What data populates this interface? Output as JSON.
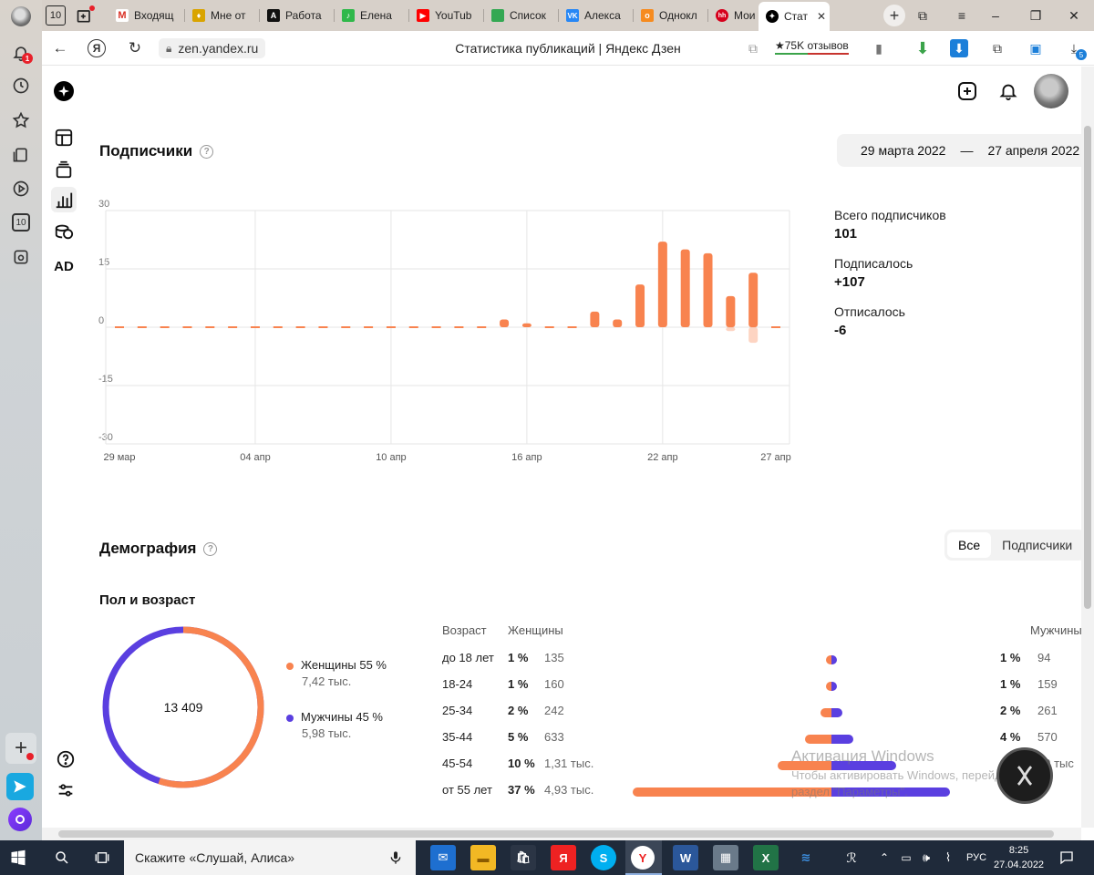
{
  "colors": {
    "orange": "#f8834f",
    "purple": "#5a3fe0"
  },
  "browser": {
    "tabs": [
      {
        "label": "Входящ",
        "icon": "gmail-icon",
        "color": "#d93025"
      },
      {
        "label": "Мне от",
        "icon": "shield-icon",
        "color": "#d9a400"
      },
      {
        "label": "Работа",
        "icon": "a-icon",
        "color": "#111111"
      },
      {
        "label": "Елена ",
        "icon": "music-icon",
        "color": "#2fb84a"
      },
      {
        "label": "YouTub",
        "icon": "youtube-icon",
        "color": "#ff0000"
      },
      {
        "label": "Список",
        "icon": "sheet-icon",
        "color": "#34a853"
      },
      {
        "label": "Алекса",
        "icon": "vk-icon",
        "color": "#2787f5"
      },
      {
        "label": "Однокл",
        "icon": "ok-icon",
        "color": "#f68b1f"
      },
      {
        "label": "Мои ре",
        "icon": "hh-icon",
        "color": "#d6001c"
      }
    ],
    "active_tab": {
      "label": "Стат",
      "icon": "zen-icon"
    },
    "tab_count": "10",
    "sidebar_badge": "1",
    "sidebar_counter": "10",
    "url": "zen.yandex.ru",
    "page_title": "Статистика публикаций | Яндекс Дзен",
    "reviews": "★75K отзывов",
    "downloads_badge": "5",
    "ya_letter": "Я"
  },
  "nav": {
    "ad_label": "AD"
  },
  "subscribers": {
    "title": "Подписчики",
    "date_from": "29 марта 2022",
    "date_sep": "—",
    "date_to": "27 апреля 2022",
    "stats": [
      {
        "label": "Всего подписчиков",
        "value": "101"
      },
      {
        "label": "Подписалось",
        "value": "+107"
      },
      {
        "label": "Отписалось",
        "value": "-6"
      }
    ]
  },
  "chart_data": {
    "type": "bar",
    "y_ticks": [
      "30",
      "15",
      "0",
      "-15",
      "-30"
    ],
    "ylim": [
      -30,
      30
    ],
    "x_tick_labels": [
      "29 мар",
      "04 апр",
      "10 апр",
      "16 апр",
      "22 апр",
      "27 апр"
    ],
    "x_tick_index": [
      0,
      6,
      12,
      18,
      24,
      29
    ],
    "series": [
      {
        "values": [
          0,
          0,
          0,
          0,
          0,
          0,
          0,
          0,
          0,
          0,
          0,
          0,
          0,
          0,
          0,
          0,
          0,
          2,
          1,
          0,
          0,
          4,
          2,
          11,
          22,
          20,
          19,
          8,
          14,
          0
        ]
      },
      {
        "values": [
          0,
          0,
          0,
          0,
          0,
          0,
          0,
          0,
          0,
          0,
          0,
          0,
          0,
          0,
          0,
          0,
          0,
          0,
          0,
          0,
          0,
          0,
          0,
          0,
          0,
          0,
          0,
          -1,
          -4,
          0
        ]
      }
    ]
  },
  "demography": {
    "title": "Демография",
    "toggle": [
      "Все",
      "Подписчики"
    ],
    "gender_title": "Пол и возраст",
    "total": "13 409",
    "women_share": 55,
    "women_label": "Женщины 55 %",
    "women_count": "7,42 тыс.",
    "men_label": "Мужчины 45 %",
    "men_count": "5,98 тыс.",
    "headers": {
      "age": "Возраст",
      "women": "Женщины",
      "men": "Мужчины"
    },
    "rows": [
      {
        "age": "до 18 лет",
        "fp": "1 %",
        "fc": "135",
        "mp": "1 %",
        "mc": "94",
        "f": 1,
        "m": 1
      },
      {
        "age": "18-24",
        "fp": "1 %",
        "fc": "160",
        "mp": "1 %",
        "mc": "159",
        "f": 1,
        "m": 1
      },
      {
        "age": "25-34",
        "fp": "2 %",
        "fc": "242",
        "mp": "2 %",
        "mc": "261",
        "f": 2,
        "m": 2
      },
      {
        "age": "35-44",
        "fp": "5 %",
        "fc": "633",
        "mp": "4 %",
        "mc": "570",
        "f": 5,
        "m": 4
      },
      {
        "age": "45-54",
        "fp": "10 %",
        "fc": "1,31 тыс.",
        "mp": "",
        "mc": "59 тыс",
        "f": 10,
        "m": 12
      },
      {
        "age": "от 55 лет",
        "fp": "37 %",
        "fc": "4,93 тыс.",
        "mp": "",
        "mc": "",
        "f": 37,
        "m": 22
      }
    ]
  },
  "watermark": {
    "line1": "Активация Windows",
    "line2": "Чтобы активировать Windows, перейдите в",
    "line3": "раздел \"Параметры\"."
  },
  "taskbar": {
    "search_placeholder": "Скажите «Слушай, Алиса»",
    "lang": "РУС",
    "time": "8:25",
    "date": "27.04.2022"
  }
}
